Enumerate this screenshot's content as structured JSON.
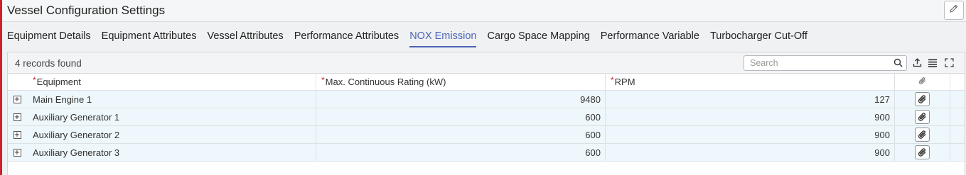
{
  "app": {
    "title": "Vessel Configuration Settings",
    "edit_icon": "pencil-icon"
  },
  "tabs": [
    {
      "label": "Equipment Details",
      "active": false
    },
    {
      "label": "Equipment Attributes",
      "active": false
    },
    {
      "label": "Vessel Attributes",
      "active": false
    },
    {
      "label": "Performance Attributes",
      "active": false
    },
    {
      "label": "NOX Emission",
      "active": true
    },
    {
      "label": "Cargo Space Mapping",
      "active": false
    },
    {
      "label": "Performance Variable",
      "active": false
    },
    {
      "label": "Turbocharger Cut-Off",
      "active": false
    }
  ],
  "grid": {
    "records_text": "4 records found",
    "search": {
      "placeholder": "Search",
      "value": ""
    },
    "toolbar_icons": [
      "export-icon",
      "columns-icon",
      "fullscreen-icon"
    ],
    "columns": [
      {
        "label": "Equipment",
        "required": true
      },
      {
        "label": "Max. Continuous Rating (kW)",
        "required": true
      },
      {
        "label": "RPM",
        "required": true
      }
    ],
    "attachment_column_icon": "paperclip-icon",
    "rows": [
      {
        "equipment": "Main Engine 1",
        "mcr": "9480",
        "rpm": "127"
      },
      {
        "equipment": "Auxiliary Generator 1",
        "mcr": "600",
        "rpm": "900"
      },
      {
        "equipment": "Auxiliary Generator 2",
        "mcr": "600",
        "rpm": "900"
      },
      {
        "equipment": "Auxiliary Generator 3",
        "mcr": "600",
        "rpm": "900"
      }
    ]
  },
  "colors": {
    "accent": "#4a64b8",
    "required": "#d0202a",
    "row_bg": "#eef7fb",
    "left_bar": "#d0202a"
  }
}
